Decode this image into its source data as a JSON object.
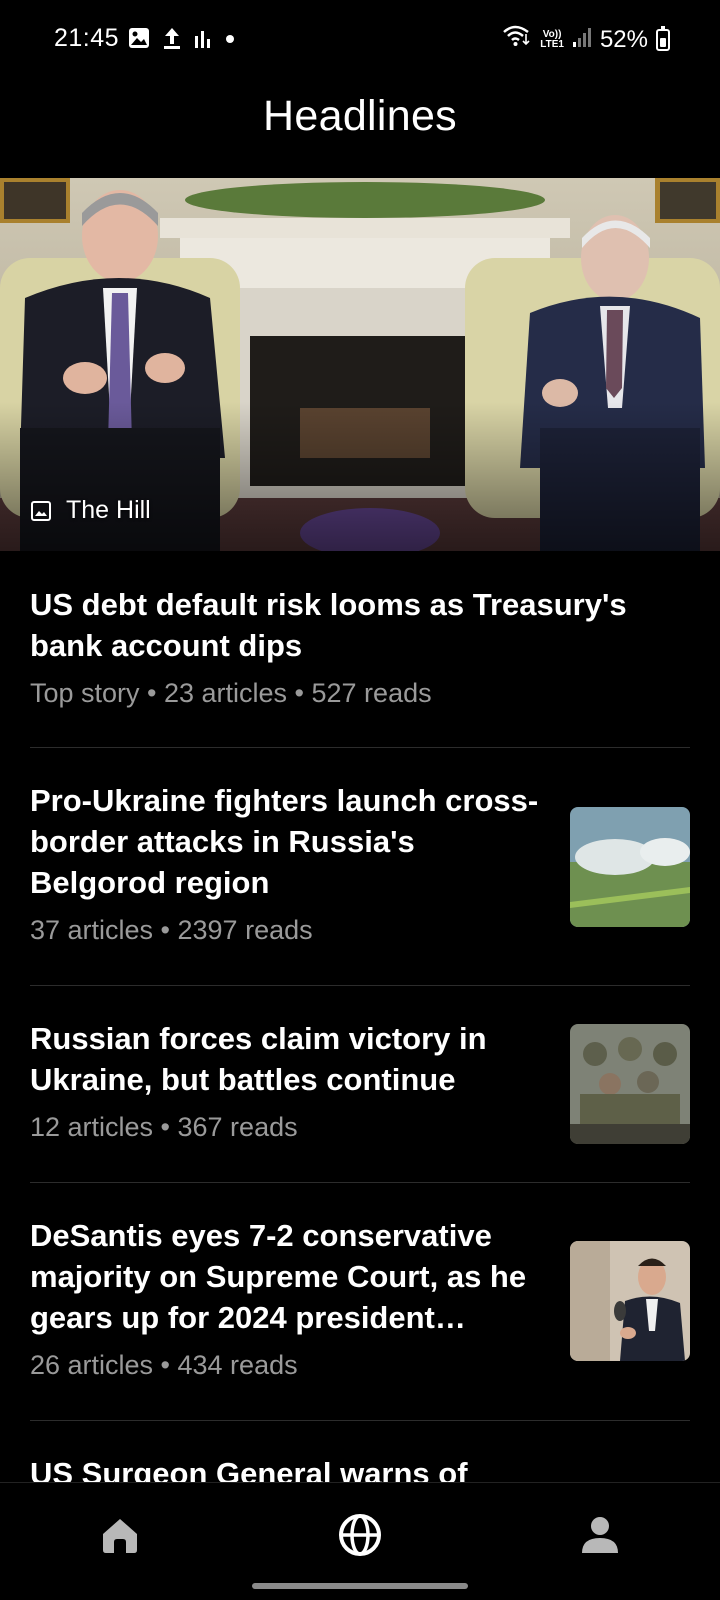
{
  "status_bar": {
    "time": "21:45",
    "battery": "52%",
    "network_label": "LTE1",
    "volte_label": "Vo))",
    "left_icons": [
      "gallery-icon",
      "upload-icon",
      "signal-bars-icon",
      "dot-icon"
    ],
    "right_icons": [
      "wifi-icon",
      "volte-icon",
      "cell-signal-icon",
      "battery-icon"
    ]
  },
  "header": {
    "title": "Headlines"
  },
  "hero": {
    "source": "The Hill",
    "source_icon": "image-icon"
  },
  "stories": [
    {
      "title": "US debt default risk looms as Treasury's bank account dips",
      "meta": "Top story • 23 articles • 527 reads"
    },
    {
      "title": "Pro-Ukraine fighters launch cross-border attacks in Russia's Belgorod region",
      "meta": "37 articles • 2397 reads"
    },
    {
      "title": "Russian forces claim victory in Ukraine, but battles continue",
      "meta": "12 articles • 367 reads"
    },
    {
      "title": "DeSantis eyes 7-2 conservative majority on Supreme Court, as he gears up for 2024 president…",
      "meta": "26 articles • 434 reads"
    },
    {
      "title": "US Surgeon General warns of",
      "meta": ""
    }
  ],
  "nav": {
    "items": [
      {
        "name": "home",
        "icon": "home-icon",
        "active": false
      },
      {
        "name": "headlines",
        "icon": "globe-icon",
        "active": true
      },
      {
        "name": "profile",
        "icon": "person-icon",
        "active": false
      }
    ]
  },
  "colors": {
    "background": "#000000",
    "text": "#ffffff",
    "meta": "#9a9a9a",
    "divider": "#2c2c2c",
    "inactive_icon": "#b8b8b8"
  }
}
